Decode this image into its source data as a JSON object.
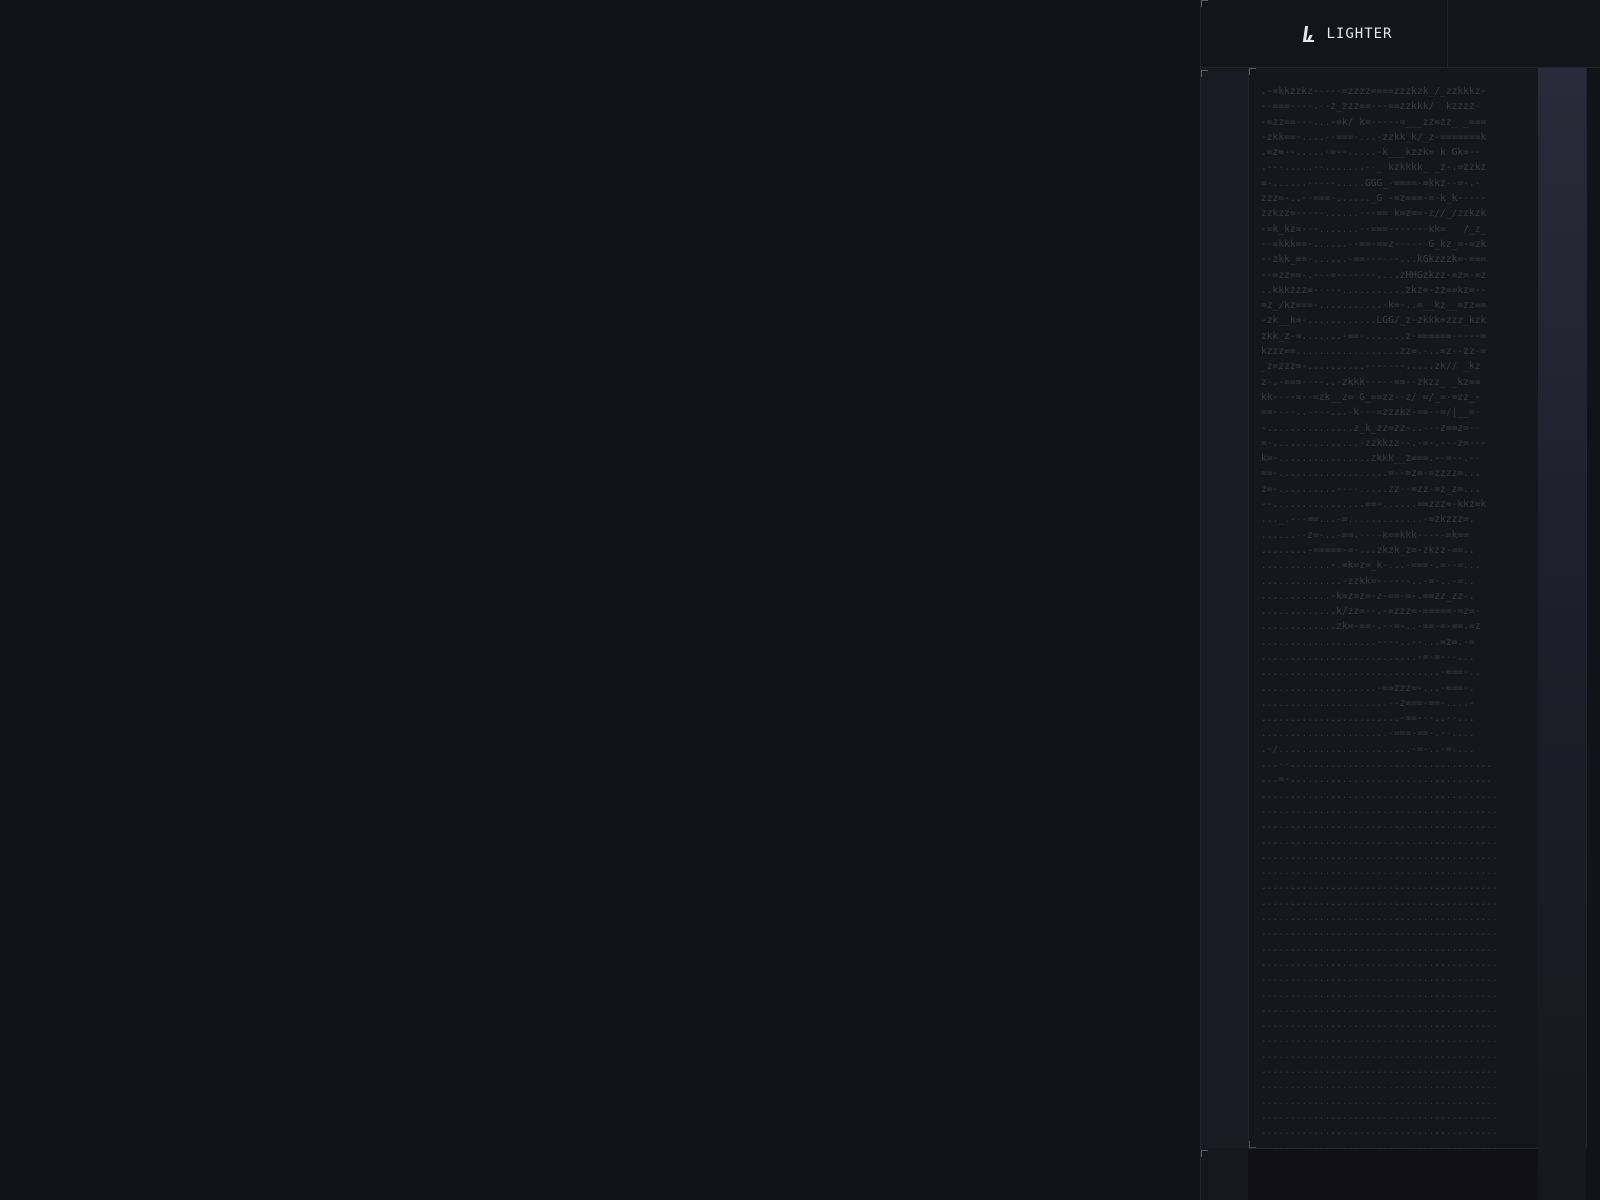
{
  "header": {
    "brand_name": "LIGHTER",
    "logo_icon": "lighter-logo-icon"
  },
  "ascii_art": {
    "lines": [
      ".-=kkzzkz-----=zzzz====zzzkzk_/_zzkkkz-",
      "--===----.--z_zzz==---==zzkkk/  kzzzz-",
      "-=zz==---...-=k/ k=-----=___zz=zz_ _===",
      "-zkk==-....--===-...-zzkk_k/_z-=======k",
      ".=z=--.....-=--.....-k___kzzk= k Gk=--",
      ".---.....--.......--_ kzkkkk_ _z-.=zzkz",
      "=-......-----.....GGG_-====-=kkz--=-.-",
      "zzz=-..--===-......_G -=z===-=-k_k-----",
      "zzkzz=-----......---== k=z==-z//_/zzkzk",
      "-=k_kz=---.......--===-------kk=   /_z_",
      "--=kkk==-......--==-==z----- G_kz_=-=zk",
      "--zkk_==-......-==------...kGkzzzk=-===",
      "--=zz==-.---=-------....zHHGzkzz-=z=-=z",
      "..kkkzzz=-----...........zkz=-zz==kz=--",
      "=z_/kz===-...........-k=-..=__kz__=zz==",
      "-zk__k=-............LGG/_z-zkkk=zzz_kzk",
      "zkk_z-=.......-==-.......z-======-----=",
      "kzzz==..................zz=.-..=z--zz-=",
      "_z=zzz=-..........-------.....zk// _kz",
      "z-.-===----..-zkkk-----==--zkzz_ _kz==",
      "kk----=--=zk__z= G_==zz--z/ =/_=-=zz_-",
      "==----..----...-k---=zzzkz-==--=/|__=-",
      "-...............z_k_zz=zz-..---z==z=--",
      "=-...............-zzkkzz--.-=-.---z=---",
      "k=-................zkkk__z===.--=--.--",
      "==-...................=--=z=-=zzzz=...",
      "z=-..........----.....zz--=zz-=z_z=...",
      "--................==-......==zzz=-kkz=k",
      "..._.---==...-=.............-=zkzzz=.",
      "......--z=-..-==.----k==kkk-----=k==",
      "........-=====-=-...zkzk_z=-zkzz-==..",
      "............-.=k=z=_k-...-===-.=--=...",
      "..............-zzkk=------..-=-..-=..",
      "............-k=z=z=-z-==-=-.==zz_zz-.",
      ".............k/zz=--.-=zzz=-=====-=z=-",
      ".............zk=-==-.--=-..-==-=-==.=z",
      "....................----..--...=z=.-=",
      "...........................-=-=---...",
      "...............................-===-..",
      "....................-==zzz=-...-===-.",
      "......................--z===-==-....-",
      "........................-==---..--...",
      "......................-===-==-.--....",
      ".-/.......................-=-..-=....",
      "...--...................................",
      "...=-...................................",
      ".........................................",
      ".........................................",
      ".........................................",
      ".........................................",
      ".........................................",
      ".........................................",
      ".........................................",
      ".........................................",
      ".........................................",
      ".........................................",
      ".........................................",
      ".........................................",
      ".........................................",
      ".........................................",
      ".........................................",
      ".........................................",
      ".........................................",
      ".........................................",
      ".........................................",
      ".........................................",
      ".........................................",
      ".........................................",
      ".........................................",
      "........................................."
    ]
  },
  "colors": {
    "background": "#12121a",
    "panel": "#16161e",
    "ascii_text": "#3a3a4a",
    "brand_text": "#e6e6ee"
  }
}
